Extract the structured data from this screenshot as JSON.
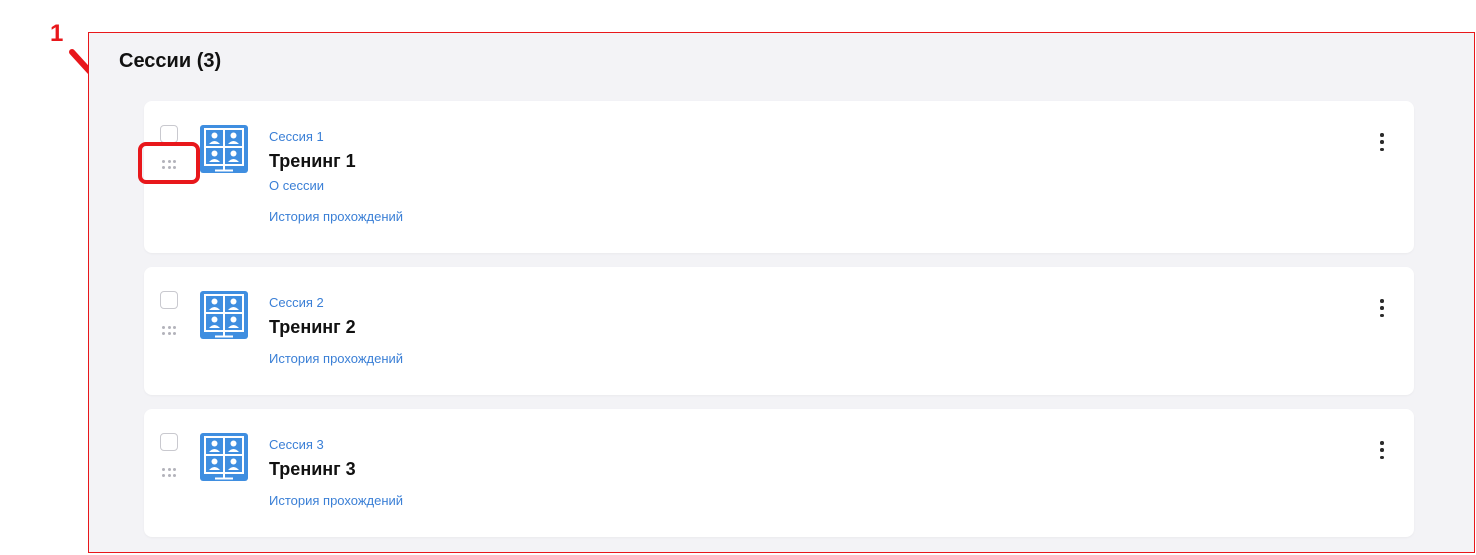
{
  "annotation": {
    "number": "1",
    "color": "#e8171b"
  },
  "panel": {
    "title": "Сессии (3)"
  },
  "colors": {
    "accent": "#3a7fd6",
    "icon_bg": "#3f8ee0",
    "panel_bg": "#f3f3f6"
  },
  "sessions": [
    {
      "label": "Сессия 1",
      "name": "Тренинг 1",
      "about_link": "О сессии",
      "history_link": "История прохождений",
      "icon": "video-conference-icon"
    },
    {
      "label": "Сессия 2",
      "name": "Тренинг 2",
      "history_link": "История прохождений",
      "icon": "video-conference-icon"
    },
    {
      "label": "Сессия 3",
      "name": "Тренинг 3",
      "history_link": "История прохождений",
      "icon": "video-conference-icon"
    }
  ]
}
